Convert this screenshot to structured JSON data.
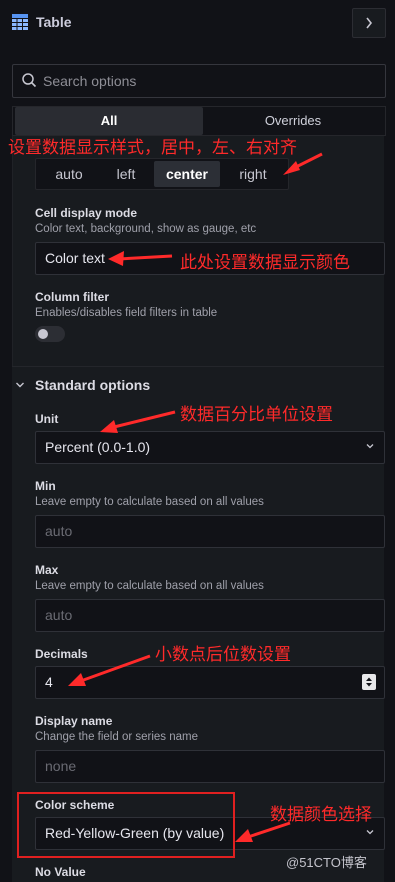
{
  "header": {
    "title": "Table",
    "table_icon": "table-grid-icon",
    "chevron_icon": "chevron-right-icon"
  },
  "search": {
    "placeholder": "Search options",
    "icon": "search-icon"
  },
  "tabs": [
    {
      "label": "All",
      "active": true
    },
    {
      "label": "Overrides",
      "active": false
    }
  ],
  "alignment": {
    "options": [
      "auto",
      "left",
      "center",
      "right"
    ],
    "selected": "center"
  },
  "cell_display_mode": {
    "label": "Cell display mode",
    "description": "Color text, background, show as gauge, etc",
    "value": "Color text"
  },
  "column_filter": {
    "label": "Column filter",
    "description": "Enables/disables field filters in table",
    "enabled": false
  },
  "standard_options": {
    "title": "Standard options",
    "unit": {
      "label": "Unit",
      "value": "Percent (0.0-1.0)"
    },
    "min": {
      "label": "Min",
      "description": "Leave empty to calculate based on all values",
      "placeholder": "auto"
    },
    "max": {
      "label": "Max",
      "description": "Leave empty to calculate based on all values",
      "placeholder": "auto"
    },
    "decimals": {
      "label": "Decimals",
      "value": "4"
    },
    "display_name": {
      "label": "Display name",
      "description": "Change the field or series name",
      "placeholder": "none"
    },
    "color_scheme": {
      "label": "Color scheme",
      "value": "Red-Yellow-Green (by value)"
    },
    "no_value": {
      "label": "No Value"
    }
  },
  "annotations": {
    "alignment": "设置数据显示样式，居中，左、右对齐",
    "cell_color": "此处设置数据显示颜色",
    "unit": "数据百分比单位设置",
    "decimals": "小数点后位数设置",
    "color_scheme": "数据颜色选择",
    "color": "#ff2a2a"
  },
  "watermark": "@51CTO博客"
}
